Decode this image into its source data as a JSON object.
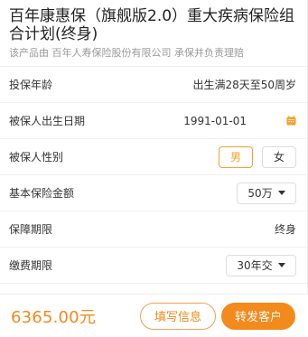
{
  "product": {
    "title": "百年康惠保（旗舰版2.0）重大疾病保险组合计划(终身)",
    "underwriter_note": "该产品由 百年人寿保险股份有限公司 承保并负责理赔"
  },
  "form": {
    "age_label": "投保年龄",
    "age_value": "出生满28天至50周岁",
    "birthdate_label": "被保人出生日期",
    "birthdate_value": "1991-01-01",
    "gender_label": "被保人性别",
    "gender_options": [
      "男",
      "女"
    ],
    "gender_selected": "男",
    "sum_insured_label": "基本保险金额",
    "sum_insured_value": "50万",
    "coverage_label": "保障期限",
    "coverage_value": "终身",
    "payment_label": "缴费期限",
    "payment_value": "30年交"
  },
  "footer": {
    "price": "6365.00元",
    "fill_button": "填写信息",
    "share_button": "转发客户"
  },
  "colors": {
    "accent": "#f28a1c",
    "accent_light": "#f3a12c"
  },
  "icons": {
    "calendar": "calendar-icon",
    "dropdown": "chevron-down-icon"
  }
}
